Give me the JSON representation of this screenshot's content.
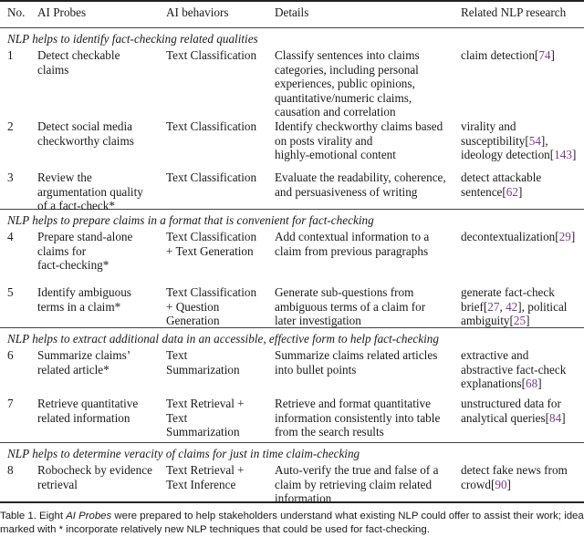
{
  "table": {
    "headers": [
      "No.",
      "AI Probes",
      "AI behaviors",
      "Details",
      "Related NLP research"
    ],
    "sections": [
      {
        "title": "NLP helps to identify fact-checking related qualities",
        "rows": [
          {
            "no": "1",
            "probe": "Detect checkable\nclaims",
            "behavior": "Text Classification",
            "details": "Classify sentences into claims\ncategories, including personal\nexperiences, public opinions,\nquantitative/numeric claims,\ncausation and correlation",
            "research": [
              {
                "text": "claim detection["
              },
              {
                "text": "74",
                "cite": true
              },
              {
                "text": "]"
              }
            ]
          },
          {
            "no": "2",
            "probe": "Detect social media\ncheckworthy claims",
            "behavior": "Text Classification",
            "details": "Identify checkworthy claims based\non posts virality and\nhighly-emotional content",
            "research": [
              {
                "text": "virality and\nsusceptibility["
              },
              {
                "text": "54",
                "cite": true
              },
              {
                "text": "],\nideology detection["
              },
              {
                "text": "143",
                "cite": true
              },
              {
                "text": "]"
              }
            ]
          },
          {
            "no": "3",
            "probe": "Review the\nargumentation quality\nof a fact-check*",
            "behavior": "Text Classification",
            "details": "Evaluate the readability, coherence,\nand persuasiveness of writing",
            "research": [
              {
                "text": "detect attackable\nsentence["
              },
              {
                "text": "62",
                "cite": true
              },
              {
                "text": "]"
              }
            ]
          }
        ]
      },
      {
        "title": "NLP helps to prepare claims in a format that is convenient for fact-checking",
        "rows": [
          {
            "no": "4",
            "probe": "Prepare stand-alone\nclaims for\nfact-checking*",
            "behavior": "Text Classification\n+ Text Generation",
            "details": "Add contextual information to a\nclaim from previous paragraphs",
            "research": [
              {
                "text": "decontextualization["
              },
              {
                "text": "29",
                "cite": true
              },
              {
                "text": "]"
              }
            ]
          },
          {
            "no": "5",
            "probe": "Identify ambiguous\nterms in a claim*",
            "behavior": "Text Classification\n+ Question\nGeneration",
            "details": "Generate sub-questions from\nambiguous terms of a claim for\nlater investigation",
            "research": [
              {
                "text": "generate fact-check\nbrief["
              },
              {
                "text": "27",
                "cite": true
              },
              {
                "text": ", "
              },
              {
                "text": "42",
                "cite": true
              },
              {
                "text": "], political\nambiguity["
              },
              {
                "text": "25",
                "cite": true
              },
              {
                "text": "]"
              }
            ]
          }
        ]
      },
      {
        "title": "NLP helps to extract additional data in an accessible, effective form to help fact-checking",
        "rows": [
          {
            "no": "6",
            "probe": "Summarize claims’\nrelated article*",
            "behavior": "Text\nSummarization",
            "details": "Summarize claims related articles\ninto bullet points",
            "research": [
              {
                "text": "extractive and\nabstractive fact-check\nexplanations["
              },
              {
                "text": "68",
                "cite": true
              },
              {
                "text": "]"
              }
            ]
          },
          {
            "no": "7",
            "probe": "Retrieve quantitative\nrelated information",
            "behavior": "Text Retrieval +\nText\nSummarization",
            "details": "Retrieve and format quantitative\ninformation consistently into table\nfrom the search results",
            "research": [
              {
                "text": "unstructured data for\nanalytical queries["
              },
              {
                "text": "84",
                "cite": true
              },
              {
                "text": "]"
              }
            ]
          }
        ]
      },
      {
        "title": "NLP helps to determine veracity of claims for just in time claim-checking",
        "rows": [
          {
            "no": "8",
            "probe": "Robocheck by evidence\nretrieval",
            "behavior": "Text Retrieval +\nText Inference",
            "details": "Auto-verify the true and false of a\nclaim by retrieving claim related\ninformation",
            "research": [
              {
                "text": "detect fake news from\ncrowd["
              },
              {
                "text": "90",
                "cite": true
              },
              {
                "text": "]"
              }
            ]
          }
        ]
      }
    ]
  },
  "caption": {
    "line1_pre": "Table 1.  Eight ",
    "line1_italic": "AI Probes",
    "line1_post": " were prepared to help stakeholders understand what existing NLP could offer to assist their work; ideas",
    "line2": "marked with * incorporate relatively new NLP techniques that could be used for fact-checking."
  },
  "colors": {
    "citation": "#7a3b8f",
    "text": "#1a1a1a",
    "rule": "#222222"
  }
}
